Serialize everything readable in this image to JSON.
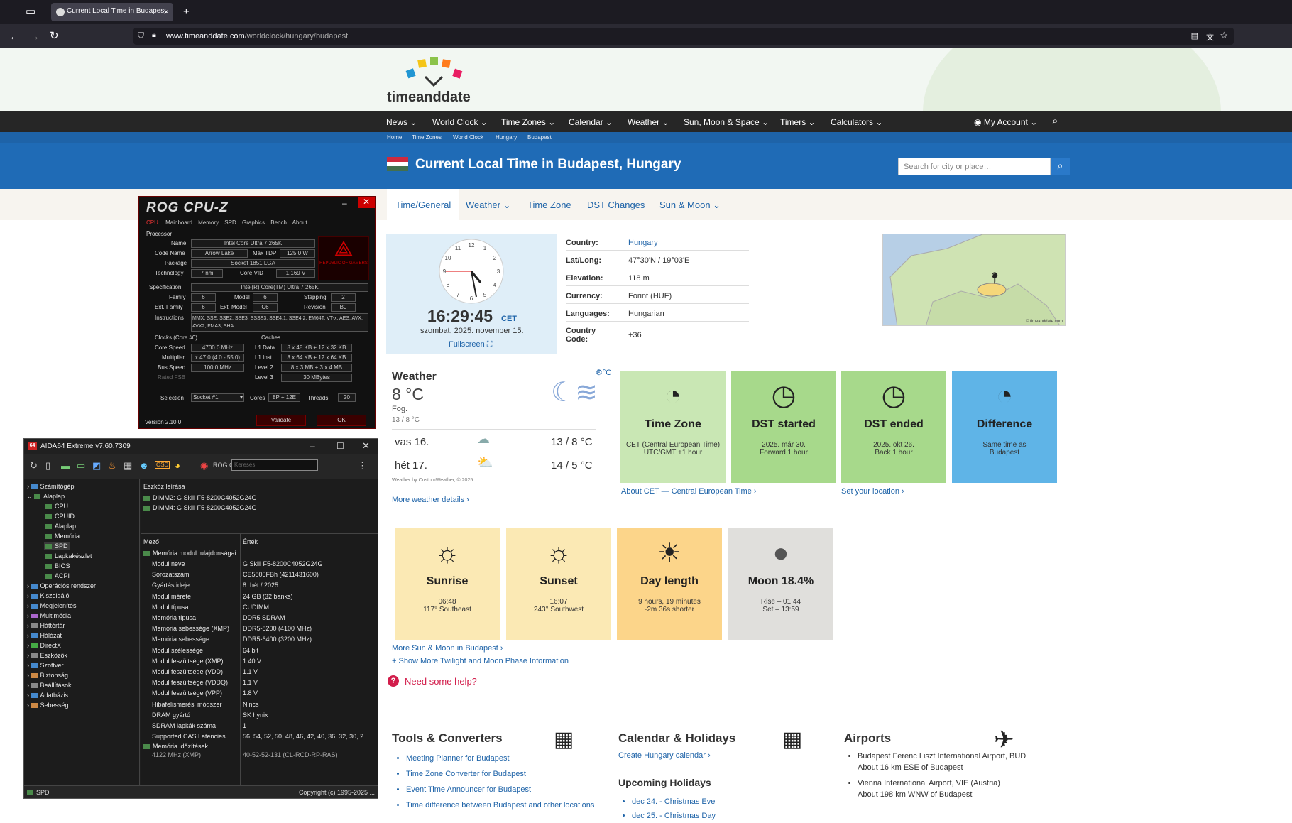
{
  "browser": {
    "tab_title": "Current Local Time in Budapest",
    "url_domain": "www.timeanddate.com",
    "url_path": "/worldclock/hungary/budapest"
  },
  "site": {
    "logo": "timeanddate",
    "nav": [
      "News",
      "World Clock",
      "Time Zones",
      "Calendar",
      "Weather",
      "Sun, Moon & Space",
      "Timers",
      "Calculators"
    ],
    "account": "My Account",
    "breadcrumb": [
      "Home",
      "Time Zones",
      "World Clock",
      "Hungary",
      "Budapest"
    ],
    "page_title": "Current Local Time in Budapest, Hungary",
    "search_placeholder": "Search for city or place…",
    "subtabs": [
      "Time/General",
      "Weather",
      "Time Zone",
      "DST Changes",
      "Sun & Moon"
    ]
  },
  "clock": {
    "time": "16:29:45",
    "tz": "CET",
    "date": "szombat, 2025. november 15.",
    "fullscreen": "Fullscreen",
    "numbers": [
      "12",
      "1",
      "2",
      "3",
      "4",
      "5",
      "6",
      "7",
      "8",
      "9",
      "10",
      "11"
    ]
  },
  "info": [
    {
      "k": "Country:",
      "v": "Hungary"
    },
    {
      "k": "Lat/Long:",
      "v": "47°30'N / 19°03'E"
    },
    {
      "k": "Elevation:",
      "v": "118 m"
    },
    {
      "k": "Currency:",
      "v": "Forint (HUF)"
    },
    {
      "k": "Languages:",
      "v": "Hungarian"
    },
    {
      "k": "Country Code:",
      "v": "+36"
    }
  ],
  "map_credit": "© timeanddate.com",
  "weather": {
    "title": "Weather",
    "unit_toggle": "°C",
    "temp": "8 °C",
    "cond": "Fog.",
    "range": "13 / 8 °C",
    "days": [
      {
        "d": "vas 16.",
        "t": "13 / 8 °C"
      },
      {
        "d": "hét 17.",
        "t": "14 / 5 °C"
      }
    ],
    "credit": "Weather by CustomWeather, © 2025",
    "more": "More weather details"
  },
  "tiles": [
    {
      "title": "Time Zone",
      "sub1": "CET (Central European Time)",
      "sub2": "UTC/GMT +1 hour"
    },
    {
      "title": "DST started",
      "sub1": "2025. már 30.",
      "sub2": "Forward 1 hour"
    },
    {
      "title": "DST ended",
      "sub1": "2025. okt 26.",
      "sub2": "Back 1 hour"
    },
    {
      "title": "Difference",
      "sub1": "Same time as",
      "sub2": "Budapest"
    }
  ],
  "tile_links": {
    "about": "About CET — Central European Time",
    "location": "Set your location"
  },
  "sun_tiles": [
    {
      "title": "Sunrise",
      "sub1": "06:48",
      "sub2": "117° Southeast"
    },
    {
      "title": "Sunset",
      "sub1": "16:07",
      "sub2": "243° Southwest"
    },
    {
      "title": "Day length",
      "sub1": "9 hours, 19 minutes",
      "sub2": "-2m 36s shorter"
    },
    {
      "title": "Moon 18.4%",
      "sub1": "Rise – 01:44",
      "sub2": "Set – 13:59"
    }
  ],
  "sun_links": {
    "more": "More Sun & Moon in Budapest",
    "twilight": "+ Show More Twilight and Moon Phase Information"
  },
  "help": "Need some help?",
  "tools": {
    "title": "Tools & Converters",
    "items": [
      "Meeting Planner for Budapest",
      "Time Zone Converter for Budapest",
      "Event Time Announcer for Budapest",
      "Time difference between Budapest and other locations"
    ]
  },
  "calendar": {
    "title": "Calendar & Holidays",
    "link": "Create Hungary calendar",
    "holidays_title": "Upcoming Holidays",
    "holidays": [
      "dec 24. - Christmas Eve",
      "dec 25. - Christmas Day"
    ]
  },
  "airports": {
    "title": "Airports",
    "items": [
      {
        "n": "Budapest Ferenc Liszt International Airport, BUD",
        "d": "About 16 km ESE of Budapest"
      },
      {
        "n": "Vienna International Airport, VIE (Austria)",
        "d": "About 198 km WNW of Budapest"
      }
    ]
  },
  "cpuz": {
    "title": "ROG CPU-Z",
    "tabs": [
      "CPU",
      "Mainboard",
      "Memory",
      "SPD",
      "Graphics",
      "Bench",
      "About"
    ],
    "processor": "Processor",
    "name_l": "Name",
    "name": "Intel Core Ultra 7 265K",
    "code_l": "Code Name",
    "code": "Arrow Lake",
    "tdp_l": "Max TDP",
    "tdp": "125.0 W",
    "pkg_l": "Package",
    "pkg": "Socket 1851 LGA",
    "tech_l": "Technology",
    "tech": "7 nm",
    "vid_l": "Core VID",
    "vid": "1.169 V",
    "spec_l": "Specification",
    "spec": "Intel(R) Core(TM) Ultra 7 265K",
    "fam_l": "Family",
    "fam": "6",
    "model_l": "Model",
    "model": "6",
    "step_l": "Stepping",
    "step": "2",
    "efam_l": "Ext. Family",
    "efam": "6",
    "emodel_l": "Ext. Model",
    "emodel": "C6",
    "rev_l": "Revision",
    "rev": "B0",
    "inst_l": "Instructions",
    "inst": "MMX, SSE, SSE2, SSE3, SSSE3, SSE4.1, SSE4.2, EM64T, VT-x, AES, AVX, AVX2, FMA3, SHA",
    "clocks_l": "Clocks (Core #0)",
    "caches_l": "Caches",
    "cs_l": "Core Speed",
    "cs": "4700.0 MHz",
    "mul_l": "Multiplier",
    "mul": "x 47.0 (4.0 - 55.0)",
    "bus_l": "Bus Speed",
    "bus": "100.0 MHz",
    "fsb_l": "Rated FSB",
    "l1d_l": "L1 Data",
    "l1d": "8 x 48 KB + 12 x 32 KB",
    "l1i_l": "L1 Inst.",
    "l1i": "8 x 64 KB + 12 x 64 KB",
    "l2_l": "Level 2",
    "l2": "8 x 3 MB + 3 x 4 MB",
    "l3_l": "Level 3",
    "l3": "30 MBytes",
    "sel_l": "Selection",
    "sel": "Socket #1",
    "cores_l": "Cores",
    "cores": "8P + 12E",
    "thr_l": "Threads",
    "thr": "20",
    "version": "Version 2.10.0",
    "validate": "Validate",
    "ok": "OK",
    "rog_text": "REPUBLIC OF GAMERS"
  },
  "aida": {
    "title": "AIDA64 Extreme v7.60.7309",
    "search_ph": "Keresés",
    "rog": "ROG C",
    "tree": [
      "Számítógép",
      "Alaplap",
      "CPU",
      "CPUID",
      "Alaplap",
      "Memória",
      "SPD",
      "Lapkakészlet",
      "BIOS",
      "ACPI",
      "Operációs rendszer",
      "Kiszolgáló",
      "Megjelenítés",
      "Multimédia",
      "Háttértár",
      "Hálózat",
      "DirectX",
      "Eszközök",
      "Szoftver",
      "Biztonság",
      "Beállítások",
      "Adatbázis",
      "Sebesség"
    ],
    "devhead": "Eszköz leírása",
    "devices": [
      "DIMM2: G Skill F5-8200C4052G24G",
      "DIMM4: G Skill F5-8200C4052G24G"
    ],
    "col_field": "Mező",
    "col_value": "Érték",
    "section": "Memória modul tulajdonságai",
    "rows": [
      [
        "Modul neve",
        "G Skill F5-8200C4052G24G"
      ],
      [
        "Sorozatszám",
        "CE5805FBh (4211431600)"
      ],
      [
        "Gyártás ideje",
        "8. hét / 2025"
      ],
      [
        "Modul mérete",
        "24 GB (32 banks)"
      ],
      [
        "Modul típusa",
        "CUDIMM"
      ],
      [
        "Memória típusa",
        "DDR5 SDRAM"
      ],
      [
        "Memória sebessége (XMP)",
        "DDR5-8200 (4100 MHz)"
      ],
      [
        "Memória sebessége",
        "DDR5-6400 (3200 MHz)"
      ],
      [
        "Modul szélessége",
        "64 bit"
      ],
      [
        "Modul feszültsége (XMP)",
        "1.40 V"
      ],
      [
        "Modul feszültsége (VDD)",
        "1.1 V"
      ],
      [
        "Modul feszültsége (VDDQ)",
        "1.1 V"
      ],
      [
        "Modul feszültsége (VPP)",
        "1.8 V"
      ],
      [
        "Hibafelismerési módszer",
        "Nincs"
      ],
      [
        "DRAM gyártó",
        "SK hynix"
      ],
      [
        "SDRAM lapkák száma",
        "1"
      ],
      [
        "Supported CAS Latencies",
        "56, 54, 52, 50, 48, 46, 42, 40, 36, 32, 30, 2"
      ]
    ],
    "section2": "Memória időzítések",
    "section2_row": "4122 MHz (XMP)",
    "section2_val": "40-52-52-131 (CL-RCD-RP-RAS)",
    "status": "SPD",
    "copyright": "Copyright (c) 1995-2025 ..."
  }
}
